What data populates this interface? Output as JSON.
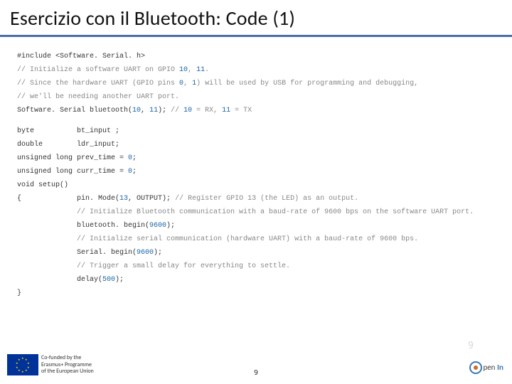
{
  "title": "Esercizio con il Bluetooth: Code (1)",
  "code": {
    "l1a": "#include <Software. Serial. h>",
    "l2a": "// Initialize a software UART on GPIO ",
    "l2n1": "10",
    "l2b": ", ",
    "l2n2": "11",
    "l2c": ".",
    "l3a": "// Since the hardware UART (GPIO pins ",
    "l3n1": "0",
    "l3b": ", ",
    "l3n2": "1",
    "l3c": ") will be used by USB for programming and debugging,",
    "l4": "// we'll be needing another UART port.",
    "l5a": "Software. Serial bluetooth(",
    "l5n1": "10",
    "l5b": ", ",
    "l5n2": "11",
    "l5c": "); ",
    "l5d": "// ",
    "l5n3": "10",
    "l5e": " = RX, ",
    "l5n4": "11",
    "l5f": " = TX",
    "l6a": "byte          bt_input ;",
    "l7a": "double        ldr_input;",
    "l8a": "unsigned long prev_time = ",
    "l8n": "0",
    "l8b": ";",
    "l9a": "unsigned long curr_time = ",
    "l9n": "0",
    "l9b": ";",
    "l10": "void setup()",
    "l11a": "{             pin. Mode(",
    "l11n": "13",
    "l11b": ", OUTPUT); ",
    "l11c": "// Register GPIO 13 (the LED) as an output.",
    "l12": "              // Initialize Bluetooth communication with a baud-rate of 9600 bps on the software UART port.",
    "l13a": "              bluetooth. begin(",
    "l13n": "9600",
    "l13b": ");",
    "l14": "              // Initialize serial communication (hardware UART) with a baud-rate of 9600 bps.",
    "l15a": "              Serial. begin(",
    "l15n": "9600",
    "l15b": ");",
    "l16": "              // Trigger a small delay for everything to settle.",
    "l17a": "              delay(",
    "l17n": "500",
    "l17b": ");",
    "l18": "}"
  },
  "footer": {
    "cofunded_l1": "Co-funded by the",
    "cofunded_l2": "Erasmus+ Programme",
    "cofunded_l3": "of the European Union",
    "page": "9",
    "phantom": "9",
    "logo_text_a": "pen",
    "logo_text_b": "In"
  }
}
